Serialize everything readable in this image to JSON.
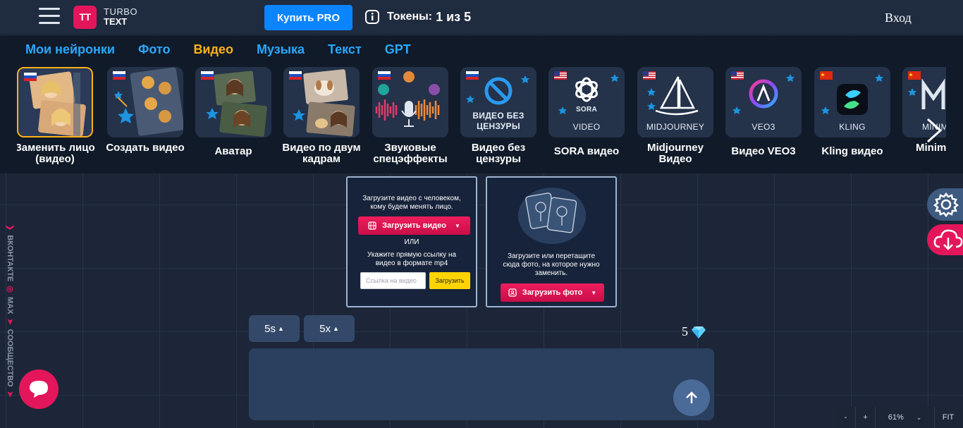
{
  "header": {
    "logo_line1": "TURBO",
    "logo_line2": "TEXT",
    "logo_mark": "TT",
    "pro_button": "Купить PRO",
    "tokens_label": "Токены:",
    "tokens_value": "1 из 5",
    "login": "Вход"
  },
  "tabs": [
    {
      "label": "Мои нейронки",
      "active": false
    },
    {
      "label": "Фото",
      "active": false
    },
    {
      "label": "Видео",
      "active": true
    },
    {
      "label": "Музыка",
      "active": false
    },
    {
      "label": "Текст",
      "active": false
    },
    {
      "label": "GPT",
      "active": false
    }
  ],
  "cards": [
    {
      "caption": "Заменить лицо (видео)",
      "flag": "ru",
      "icon": "face-swap-image",
      "active": true
    },
    {
      "caption": "Создать видео",
      "flag": "ru",
      "icon": "create-video-image",
      "active": false
    },
    {
      "caption": "Аватар",
      "flag": "ru",
      "icon": "avatar-image",
      "active": false
    },
    {
      "caption": "Видео по двум кадрам",
      "flag": "ru",
      "icon": "two-frames-image",
      "active": false
    },
    {
      "caption": "Звуковые спецэффекты",
      "flag": "ru",
      "icon": "sound-effects-image",
      "active": false
    },
    {
      "caption": "Видео без цензуры",
      "flag": "ru",
      "icon": "no-censor-icon",
      "thumb_label": "ВИДЕО БЕЗ ЦЕНЗУРЫ",
      "active": false
    },
    {
      "caption": "SORA видео",
      "flag": "us",
      "icon": "openai-icon",
      "thumb_label": "SORA",
      "thumb_label2": "VIDEO",
      "active": false
    },
    {
      "caption": "Midjourney Видео",
      "flag": "us",
      "icon": "midjourney-icon",
      "thumb_label": "MIDJOURNEY",
      "active": false
    },
    {
      "caption": "Видео VEO3",
      "flag": "us",
      "icon": "veo3-icon",
      "thumb_label": "VEO3",
      "active": false
    },
    {
      "caption": "Kling видео",
      "flag": "cn",
      "icon": "kling-icon",
      "thumb_label": "KLING",
      "active": false
    },
    {
      "caption": "Minim Виде",
      "flag": "cn",
      "icon": "minimax-icon",
      "thumb_label": "MINIM",
      "active": false
    }
  ],
  "side_links": {
    "vk": "ВКОНТАКТЕ",
    "max": "MAX",
    "community": "СООБЩЕСТВО"
  },
  "upload_video": {
    "text": "Загрузите видео с человеком, кому будем менять лицо.",
    "button": "Загрузить видео",
    "or": "ИЛИ",
    "link_text": "Укажите прямую ссылку на видео в формате mp4",
    "input_placeholder": "Ссылка на видео",
    "load_button": "Загрузить"
  },
  "upload_photo": {
    "text": "Загрузите или перетащите сюда фото, на которое нужно заменить.",
    "button": "Загрузить фото"
  },
  "controls": {
    "duration": "5s",
    "multiplier": "5x",
    "credits": "5"
  },
  "zoom": {
    "minus": "-",
    "plus": "+",
    "level": "61%",
    "fit": "FIT"
  },
  "colors": {
    "accent_blue": "#29a8ff",
    "accent_orange": "#ffb21a",
    "brand_red": "#e3165b",
    "pro_blue": "#0a84ff"
  }
}
